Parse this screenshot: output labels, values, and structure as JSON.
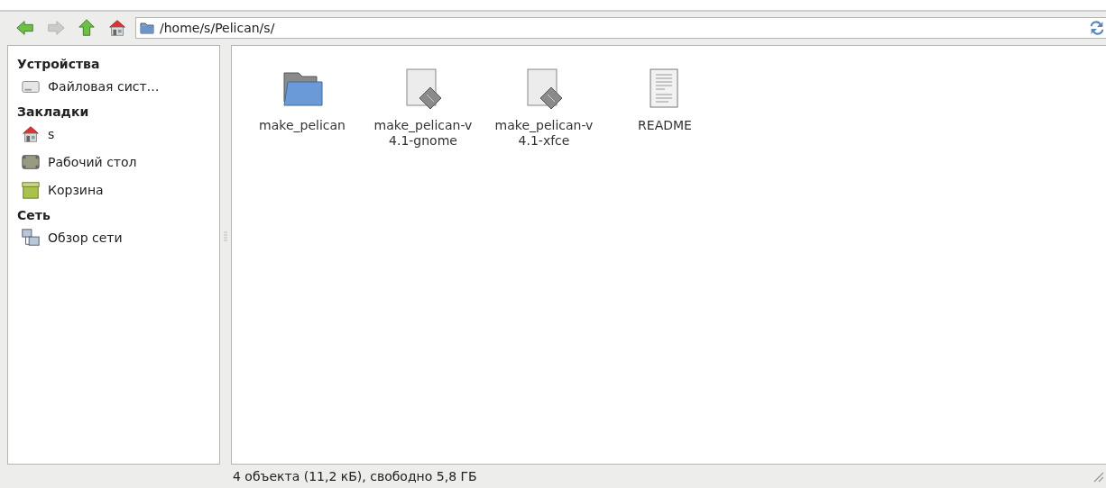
{
  "toolbar": {
    "nav_buttons": [
      {
        "kind": "back",
        "disabled": false
      },
      {
        "kind": "forward",
        "disabled": true
      },
      {
        "kind": "up",
        "disabled": false
      },
      {
        "kind": "home",
        "disabled": false
      }
    ],
    "location": {
      "value": "/home/s/Pelican/s/"
    }
  },
  "sidebar": {
    "sections": [
      {
        "heading": "Устройства",
        "items": [
          {
            "label": "Файловая сист…",
            "kind": "drive"
          }
        ]
      },
      {
        "heading": "Закладки",
        "items": [
          {
            "label": "s",
            "kind": "home"
          },
          {
            "label": "Рабочий стол",
            "kind": "desktop"
          },
          {
            "label": "Корзина",
            "kind": "trash"
          }
        ]
      },
      {
        "heading": "Сеть",
        "items": [
          {
            "label": "Обзор сети",
            "kind": "network"
          }
        ]
      }
    ]
  },
  "files": [
    {
      "name": "make_pelican",
      "kind": "folder"
    },
    {
      "name": "make_pelican-v4.1-gnome",
      "kind": "script"
    },
    {
      "name": "make_pelican-v4.1-xfce",
      "kind": "script"
    },
    {
      "name": "README",
      "kind": "text"
    }
  ],
  "status_bar": {
    "text": "4 объекта (11,2 кБ), свободно 5,8 ГБ"
  }
}
